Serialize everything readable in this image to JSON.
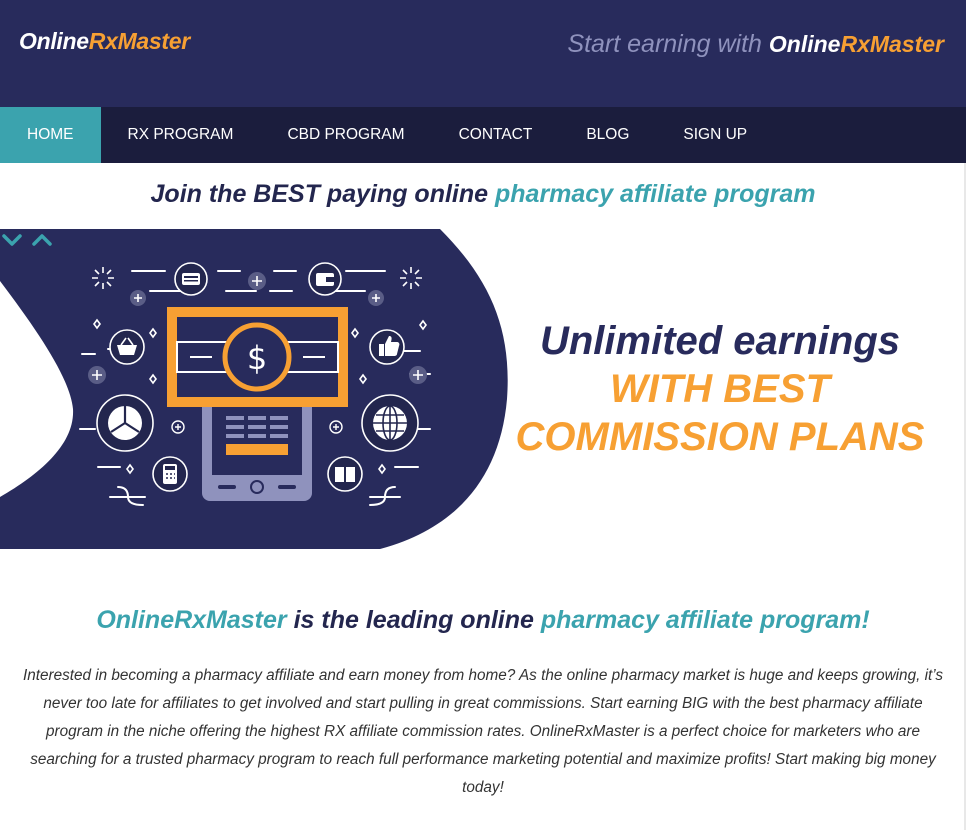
{
  "header": {
    "logo": {
      "part1": "Online",
      "part2": "RxMaster"
    },
    "tagline": {
      "prefix": "Start earning with ",
      "brand1": "Online",
      "brand2": "RxMaster"
    }
  },
  "nav": {
    "items": [
      {
        "label": "HOME",
        "active": true
      },
      {
        "label": "RX PROGRAM",
        "active": false
      },
      {
        "label": "CBD PROGRAM",
        "active": false
      },
      {
        "label": "CONTACT",
        "active": false
      },
      {
        "label": "BLOG",
        "active": false
      },
      {
        "label": "SIGN UP",
        "active": false
      }
    ]
  },
  "intro": {
    "part1": "Join the BEST paying online ",
    "part2": "pharmacy affiliate program"
  },
  "hero": {
    "line1": "Unlimited earnings",
    "line2": "WITH BEST",
    "line3": "COMMISSION PLANS",
    "money_symbol": "$",
    "icons": [
      "sparkle-icon",
      "plus-icon",
      "credit-card-icon",
      "wallet-icon",
      "shopping-basket-icon",
      "like-icon",
      "pie-chart-icon",
      "globe-icon",
      "calculator-icon",
      "book-icon",
      "mobile-phone-icon",
      "banknote-icon"
    ]
  },
  "section": {
    "title_brand": "OnlineRxMaster",
    "title_mid": " is the leading online ",
    "title_end": "pharmacy affiliate program!",
    "body": "Interested in becoming a pharmacy affiliate and earn money from home? As the online pharmacy market is huge and keeps growing, it’s never too late for affiliates to get involved and start pulling in great commissions. Start earning BIG with the best pharmacy affiliate program in the niche offering the highest RX affiliate commission rates. OnlineRxMaster is a perfect choice for marketers who are searching for a trusted pharmacy program to reach full performance marketing potential and maximize profits! Start making big money today!"
  },
  "colors": {
    "header_bg": "#282b5c",
    "nav_bg": "#1b1d3d",
    "accent_teal": "#3ba3ae",
    "accent_orange": "#f7a033",
    "text_dark": "#23264e"
  }
}
